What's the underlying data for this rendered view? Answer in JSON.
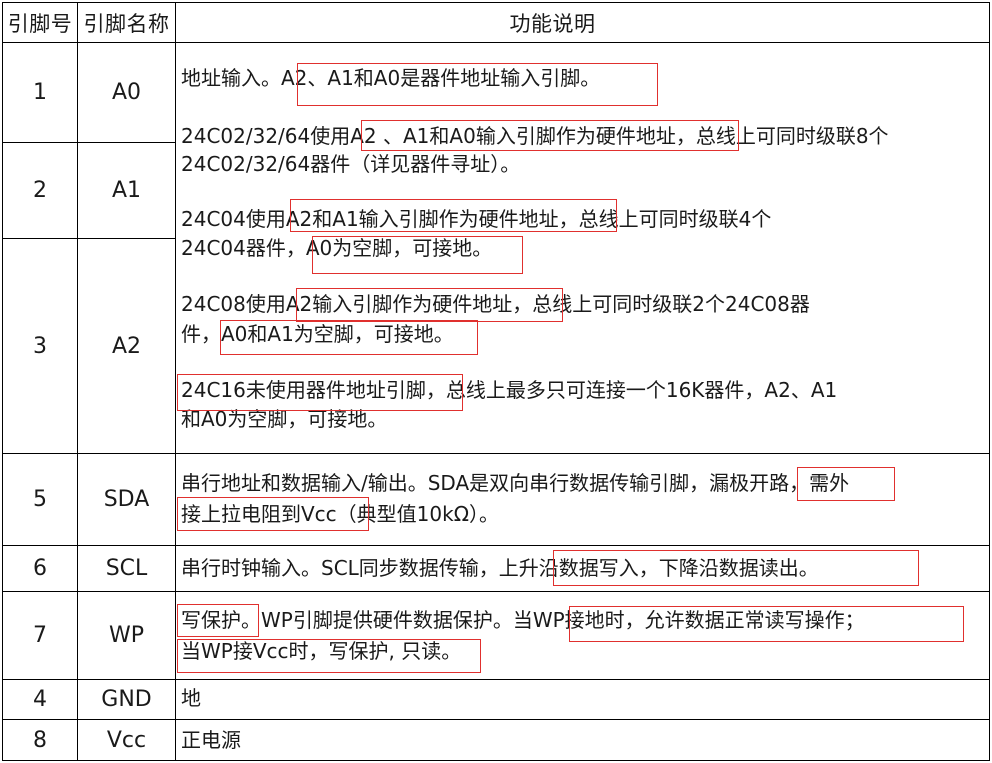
{
  "headers": {
    "pin_no": "引脚号",
    "pin_name": "引脚名称",
    "function": "功能说明"
  },
  "rows": {
    "a0": {
      "no": "1",
      "name": "A0"
    },
    "a1": {
      "no": "2",
      "name": "A1"
    },
    "a2": {
      "no": "3",
      "name": "A2"
    },
    "sda": {
      "no": "5",
      "name": "SDA"
    },
    "scl": {
      "no": "6",
      "name": "SCL"
    },
    "wp": {
      "no": "7",
      "name": "WP"
    },
    "gnd": {
      "no": "4",
      "name": "GND"
    },
    "vcc": {
      "no": "8",
      "name": "Vcc"
    }
  },
  "addr_desc": {
    "l1": "地址输入。A2、A1和A0是器件地址输入引脚。",
    "l2": "24C02/32/64使用A2 、A1和A0输入引脚作为硬件地址，总线上可同时级联8个",
    "l3": "24C02/32/64器件（详见器件寻址）。",
    "l4": "24C04使用A2和A1输入引脚作为硬件地址，总线上可同时级联4个",
    "l5": "24C04器件，A0为空脚，可接地。",
    "l6": "24C08使用A2输入引脚作为硬件地址，总线上可同时级联2个24C08器",
    "l7": "件，A0和A1为空脚，可接地。",
    "l8": "24C16未使用器件地址引脚，总线上最多只可连接一个16K器件，A2、A1",
    "l9": "和A0为空脚，可接地。"
  },
  "sda_desc": {
    "l1": "串行地址和数据输入/输出。SDA是双向串行数据传输引脚，漏极开路，需外",
    "l2": "接上拉电阻到Vcc（典型值10kΩ）。"
  },
  "scl_desc": {
    "l1": "串行时钟输入。SCL同步数据传输，上升沿数据写入，下降沿数据读出。"
  },
  "wp_desc": {
    "l1": "写保护。WP引脚提供硬件数据保护。当WP接地时，允许数据正常读写操作；",
    "l2": "当WP接Vcc时，写保护, 只读。"
  },
  "gnd_desc": {
    "l1": "地"
  },
  "vcc_desc": {
    "l1": "正电源"
  },
  "colors": {
    "highlight_box": "#e0302e",
    "grid": "#000000"
  }
}
